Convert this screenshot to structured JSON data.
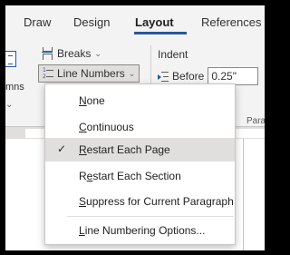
{
  "tabs": [
    {
      "label": "Draw",
      "active": false
    },
    {
      "label": "Design",
      "active": false
    },
    {
      "label": "Layout",
      "active": true
    },
    {
      "label": "References",
      "active": false
    }
  ],
  "ribbon": {
    "columns_label_partial": "mns",
    "breaks_label": "Breaks",
    "line_numbers_label": "Line Numbers",
    "indent_title": "Indent",
    "before_label": "Before",
    "before_value": "0.25\"",
    "paragraph_label_partial": "Para"
  },
  "menu": {
    "items": [
      {
        "pre": "",
        "key": "N",
        "post": "one",
        "checked": false,
        "selected": false
      },
      {
        "pre": "",
        "key": "C",
        "post": "ontinuous",
        "checked": false,
        "selected": false
      },
      {
        "pre": "",
        "key": "R",
        "post": "estart Each Page",
        "checked": true,
        "selected": true
      },
      {
        "pre": "R",
        "key": "e",
        "post": "start Each Section",
        "checked": false,
        "selected": false
      },
      {
        "pre": "",
        "key": "S",
        "post": "uppress for Current Paragraph",
        "checked": false,
        "selected": false
      },
      {
        "pre": "",
        "key": "L",
        "post": "ine Numbering Options...",
        "checked": false,
        "selected": false
      }
    ],
    "check_glyph": "✓"
  },
  "colors": {
    "accent": "#2b579a",
    "menu_selected": "#e1dfdd",
    "ribbon_bg": "#f3f3f3"
  }
}
